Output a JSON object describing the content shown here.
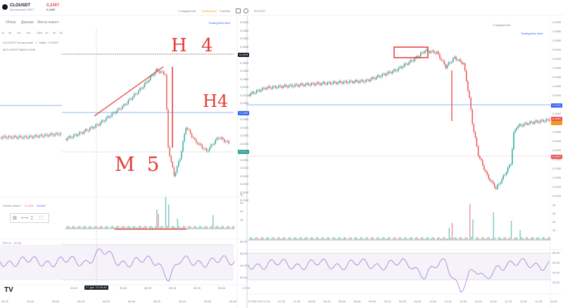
{
  "header": {
    "symbol": "CLOUSDT",
    "subtitle": "Бессрочный USDT",
    "price": "0,2497",
    "price_secondary": "0,2499",
    "right_label": "Стандартный",
    "brand": "TradingView",
    "depth_label": "Глубина",
    "time": "00:00:00"
  },
  "left_panel": {
    "tabs": [
      "Обзор",
      "Данные",
      "Линта новост"
    ],
    "timeframes": [
      "1s",
      "4h",
      "1m",
      "5m",
      "15m",
      "1h",
      "4h",
      "1D"
    ],
    "chart_title": "CLOUSDT Бессрочный · 1 · ByBit · OTHER",
    "chart_sub": "MCLOUDST ByBit 0,2499",
    "volume_label": "Объём SMA 9",
    "volume_value1": "21,47K",
    "volume_value2": "16,81K",
    "rsi_label": "RSI 14",
    "rsi_value": "57,30",
    "brand_mark": "TV"
  },
  "right_panel": {
    "top_label": "Стандартный",
    "brand": "TradingView Alert"
  },
  "annotations": {
    "h4_top": "H 4",
    "h4_mid": "H4",
    "m5": "M 5"
  },
  "price_badges": {
    "left_dark": "0,2449",
    "left_blue": "0,2350",
    "left_green": "0,2501",
    "right_blue": "0,2350",
    "right_red": "0,2497",
    "right_orange": "0,2499",
    "right_red2": "0,2497"
  },
  "left_price_ticks": [
    "0,2600",
    "0,2580",
    "0,2560",
    "0,2540",
    "0,2520",
    "0,2500",
    "0,2480",
    "0,2460",
    "0,2440",
    "0,2420",
    "0,2400",
    "0,2380",
    "0,2360",
    "0,2340",
    "0,2320",
    "0,2300",
    "0,2280",
    "0,2260",
    "0,2240",
    "0,2220",
    "0,2200",
    "0,2180",
    "0,2160"
  ],
  "right_price_ticks": [
    "0,2600",
    "0,2580",
    "0,2560",
    "0,2540",
    "0,2520",
    "0,2500",
    "0,2480",
    "0,2460",
    "0,2440",
    "0,2420",
    "0,2400",
    "0,2380",
    "0,2360",
    "0,2340",
    "0,2320",
    "0,2300",
    "0,2280",
    "0,2260",
    "0,2240",
    "0,2220"
  ],
  "left_time_ticks": [
    "04:32",
    "04:45",
    "05:00",
    "05:15",
    "05:30",
    "05:45",
    "06:00",
    "06:15",
    "06:30",
    "06:45",
    "07:00"
  ],
  "left_time_ticks2": [
    "05:15",
    "05:30",
    "05:45",
    "06:00",
    "06:15",
    "06:30",
    "06:45",
    "07:00"
  ],
  "left_cursor_time": "27 Дек '23  05:46",
  "right_time_ticks": [
    "07:00",
    "07:15",
    "07:30",
    "07:45",
    "08:00",
    "08:15",
    "08:30",
    "08:45",
    "09:00",
    "09:15",
    "09:30",
    "09:45",
    "10:00",
    "10:15",
    "10:30",
    "10:45",
    "11:00",
    "11:15",
    "11:30",
    "11:45",
    "12:00"
  ],
  "rsi_ticks": [
    "80,00",
    "60,00",
    "40,00",
    "20,00"
  ],
  "vol_ticks": [
    "4K",
    "3K",
    "2K",
    "1K"
  ],
  "colors": {
    "up": "#26a69a",
    "down": "#ef5350",
    "annotation": "#e53935",
    "rsi": "#7e57c2",
    "blue_line": "#2962ff"
  }
}
